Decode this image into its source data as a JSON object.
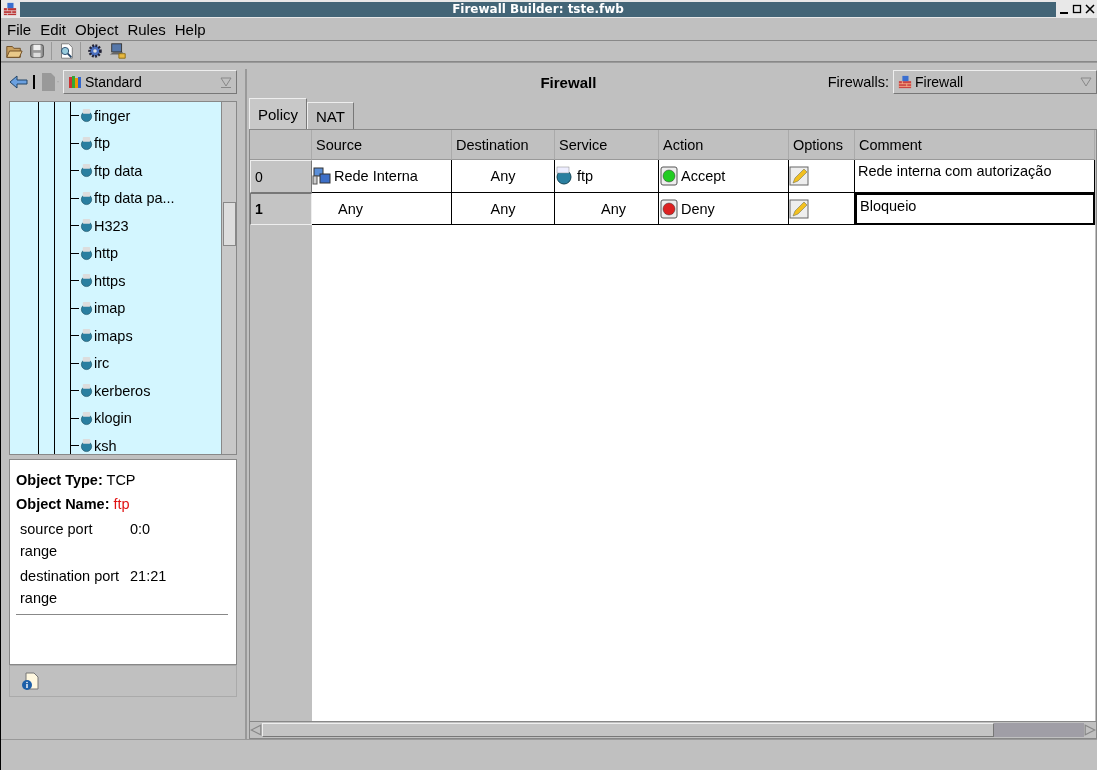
{
  "window": {
    "title": "Firewall Builder: tste.fwb"
  },
  "menu": [
    "File",
    "Edit",
    "Object",
    "Rules",
    "Help"
  ],
  "library": {
    "value": "Standard"
  },
  "tree": {
    "items": [
      {
        "label": "finger",
        "selected": false
      },
      {
        "label": "ftp",
        "selected": false
      },
      {
        "label": "ftp data",
        "selected": false
      },
      {
        "label": "ftp data pa...",
        "selected": false
      },
      {
        "label": "H323",
        "selected": false
      },
      {
        "label": "http",
        "selected": false
      },
      {
        "label": "https",
        "selected": false
      },
      {
        "label": "imap",
        "selected": false
      },
      {
        "label": "imaps",
        "selected": false
      },
      {
        "label": "irc",
        "selected": false
      },
      {
        "label": "kerberos",
        "selected": false
      },
      {
        "label": "klogin",
        "selected": false
      },
      {
        "label": "ksh",
        "selected": false
      }
    ]
  },
  "info": {
    "type_label": "Object Type:",
    "type_value": "TCP",
    "name_label": "Object Name:",
    "name_value": "ftp",
    "properties": [
      {
        "label": "source port range",
        "value": "0:0"
      },
      {
        "label": "destination port range",
        "value": "21:21"
      }
    ]
  },
  "firewall": {
    "title": "Firewall",
    "selector_label": "Firewalls:",
    "selector_value": "Firewall"
  },
  "tabs": [
    {
      "label": "Policy",
      "selected": true
    },
    {
      "label": "NAT",
      "selected": false
    }
  ],
  "table": {
    "columns": [
      "Source",
      "Destination",
      "Service",
      "Action",
      "Options",
      "Comment"
    ],
    "rows": [
      {
        "number": "0",
        "selected": false,
        "source": {
          "kind": "network",
          "text": "Rede Interna"
        },
        "destination": "Any",
        "service": {
          "kind": "tcp",
          "text": "ftp"
        },
        "action": {
          "kind": "accept",
          "text": "Accept"
        },
        "comment": "Rede interna com autorização"
      },
      {
        "number": "1",
        "selected": true,
        "source": {
          "kind": "any",
          "text": "Any"
        },
        "destination": "Any",
        "service": {
          "kind": "any",
          "text": "Any"
        },
        "action": {
          "kind": "deny",
          "text": "Deny"
        },
        "comment": "Bloqueio"
      }
    ]
  }
}
